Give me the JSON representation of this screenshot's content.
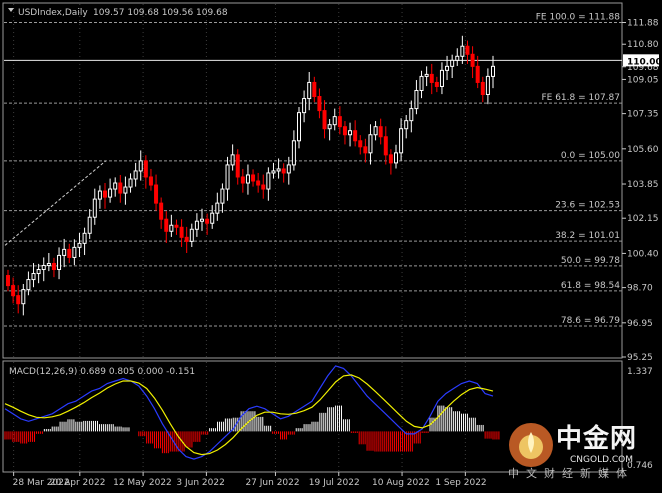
{
  "chart_header": {
    "symbol_label": "USDIndex,Daily",
    "ohlc": "109.57 109.68 109.56 109.68"
  },
  "colors": {
    "background": "#000000",
    "grid": "#3c3c3c",
    "text": "#c8c8c8",
    "candle_up": "#ffffff",
    "candle_down": "#ff0000",
    "fib_line": "#9a9a9a",
    "current_price_line": "#e8e8e8",
    "macd_line": "#2a3cff",
    "signal_line": "#f0f000",
    "hist_up": "#ffffff",
    "hist_down": "#ff0000"
  },
  "chart_data": [
    {
      "type": "candlestick",
      "title": "USDIndex,Daily",
      "y_axis_ticks": [
        111.88,
        110.8,
        110.0,
        109.68,
        109.05,
        107.35,
        105.6,
        103.85,
        102.15,
        100.4,
        98.7,
        96.95,
        95.25
      ],
      "ylim": [
        95.25,
        112.8
      ],
      "x_tick_labels": [
        "28 Mar 2022",
        "20 Apr 2022",
        "12 May 2022",
        "3 Jun 2022",
        "27 Jun 2022",
        "19 Jul 2022",
        "10 Aug 2022",
        "1 Sep 2022"
      ],
      "current_price_label": "110.00",
      "bid_label": "109.68",
      "fib_levels": [
        {
          "label": "FE 100.0 = 111.88",
          "value": 111.88
        },
        {
          "label": "FE 61.8 = 107.87",
          "value": 107.87
        },
        {
          "label": "0.0 = 105.00",
          "value": 105.0
        },
        {
          "label": "23.6 = 102.53",
          "value": 102.53
        },
        {
          "label": "38.2 = 101.01",
          "value": 101.01
        },
        {
          "label": "50.0 = 99.78",
          "value": 99.78
        },
        {
          "label": "61.8 = 98.54",
          "value": 98.54
        },
        {
          "label": "78.6 = 96.79",
          "value": 96.79
        }
      ],
      "trend_line": {
        "from": {
          "date": "25 Mar 2022",
          "price": 100.8
        },
        "to": {
          "date": "29 Apr 2022",
          "price": 105.0
        }
      },
      "candles_close": [
        98.8,
        98.3,
        97.9,
        98.6,
        99.1,
        99.4,
        99.6,
        99.8,
        99.9,
        99.6,
        100.3,
        100.6,
        100.2,
        100.7,
        100.9,
        101.4,
        102.2,
        103.1,
        103.5,
        103.2,
        103.6,
        103.9,
        103.4,
        103.7,
        104.1,
        104.5,
        105.0,
        104.2,
        103.8,
        102.9,
        102.1,
        101.5,
        101.8,
        101.7,
        101.2,
        101.0,
        101.6,
        102.0,
        102.1,
        101.9,
        102.4,
        102.9,
        103.6,
        104.8,
        105.3,
        104.2,
        103.9,
        104.3,
        104.0,
        103.8,
        103.6,
        104.4,
        104.5,
        104.6,
        104.4,
        104.8,
        106.0,
        107.4,
        108.1,
        108.9,
        108.2,
        107.5,
        106.6,
        106.8,
        107.2,
        106.7,
        106.3,
        106.5,
        106.0,
        105.7,
        105.4,
        106.3,
        106.7,
        106.2,
        105.3,
        104.9,
        105.4,
        106.6,
        107.0,
        107.6,
        108.5,
        109.2,
        109.3,
        108.9,
        108.7,
        109.5,
        109.7,
        110.0,
        110.2,
        110.7,
        110.3,
        109.7,
        108.9,
        108.3,
        109.2,
        109.7
      ],
      "candles_open": [
        99.3,
        98.8,
        98.3,
        97.9,
        98.6,
        99.1,
        99.4,
        99.6,
        99.8,
        99.9,
        99.6,
        100.3,
        100.6,
        100.2,
        100.7,
        100.9,
        101.4,
        102.2,
        103.1,
        103.5,
        103.2,
        103.6,
        103.9,
        103.4,
        103.7,
        104.1,
        104.5,
        105.0,
        104.2,
        103.8,
        102.9,
        102.1,
        101.5,
        101.8,
        101.7,
        101.2,
        101.0,
        101.6,
        102.0,
        102.1,
        101.9,
        102.4,
        102.9,
        103.6,
        104.8,
        105.3,
        104.2,
        103.9,
        104.3,
        104.0,
        103.8,
        103.6,
        104.4,
        104.5,
        104.6,
        104.4,
        104.8,
        106.0,
        107.4,
        108.1,
        108.9,
        108.2,
        107.5,
        106.6,
        106.8,
        107.2,
        106.7,
        106.3,
        106.5,
        106.0,
        105.7,
        105.4,
        106.3,
        106.7,
        106.2,
        105.3,
        104.9,
        105.4,
        106.6,
        107.0,
        107.6,
        108.5,
        109.2,
        109.3,
        108.9,
        108.7,
        109.5,
        109.7,
        110.0,
        110.2,
        110.7,
        110.3,
        109.7,
        108.9,
        108.3,
        109.2
      ]
    },
    {
      "type": "macd",
      "title": "MACD(12,26,9) 0.689 0.805 0.000 -0.151",
      "y_axis_ticks": [
        1.337,
        0.746
      ],
      "ylim": [
        -0.746,
        1.337
      ],
      "macd": [
        0.45,
        0.35,
        0.25,
        0.2,
        0.25,
        0.3,
        0.35,
        0.45,
        0.55,
        0.6,
        0.7,
        0.8,
        0.85,
        0.95,
        1.0,
        1.05,
        1.0,
        0.9,
        0.7,
        0.45,
        0.15,
        -0.1,
        -0.35,
        -0.5,
        -0.55,
        -0.5,
        -0.4,
        -0.25,
        -0.1,
        0.05,
        0.3,
        0.45,
        0.5,
        0.45,
        0.35,
        0.25,
        0.3,
        0.4,
        0.5,
        0.6,
        0.85,
        1.1,
        1.3,
        1.25,
        1.1,
        0.9,
        0.7,
        0.55,
        0.4,
        0.25,
        0.1,
        -0.05,
        -0.05,
        0.05,
        0.3,
        0.6,
        0.75,
        0.85,
        0.95,
        1.0,
        0.95,
        0.75,
        0.7
      ],
      "signal": [
        0.55,
        0.48,
        0.4,
        0.33,
        0.28,
        0.27,
        0.29,
        0.33,
        0.4,
        0.48,
        0.57,
        0.67,
        0.76,
        0.86,
        0.94,
        1.0,
        1.0,
        0.96,
        0.85,
        0.66,
        0.42,
        0.15,
        -0.1,
        -0.3,
        -0.42,
        -0.46,
        -0.44,
        -0.37,
        -0.26,
        -0.12,
        0.05,
        0.2,
        0.32,
        0.38,
        0.38,
        0.35,
        0.34,
        0.36,
        0.41,
        0.48,
        0.62,
        0.8,
        0.98,
        1.1,
        1.12,
        1.06,
        0.94,
        0.8,
        0.65,
        0.5,
        0.35,
        0.2,
        0.1,
        0.07,
        0.13,
        0.28,
        0.45,
        0.6,
        0.73,
        0.83,
        0.87,
        0.84,
        0.8
      ],
      "histogram": [
        -0.1,
        -0.13,
        -0.15,
        -0.13,
        -0.03,
        0.03,
        0.06,
        0.12,
        0.15,
        0.12,
        0.13,
        0.13,
        0.09,
        0.09,
        0.06,
        0.05,
        0.0,
        -0.06,
        -0.15,
        -0.21,
        -0.27,
        -0.25,
        -0.25,
        -0.2,
        -0.13,
        -0.04,
        0.04,
        0.12,
        0.16,
        0.17,
        0.25,
        0.25,
        0.18,
        0.07,
        -0.03,
        -0.1,
        -0.04,
        0.04,
        0.09,
        0.12,
        0.23,
        0.3,
        0.32,
        0.15,
        -0.02,
        -0.16,
        -0.24,
        -0.25,
        -0.25,
        -0.25,
        -0.25,
        -0.25,
        -0.15,
        -0.02,
        0.17,
        0.32,
        0.3,
        0.25,
        0.22,
        0.17,
        0.08,
        -0.09,
        -0.1
      ]
    }
  ],
  "watermark": {
    "brand_cn": "中金网",
    "url": "CNGOLD.COM",
    "slogan": "中文财经新媒体"
  }
}
